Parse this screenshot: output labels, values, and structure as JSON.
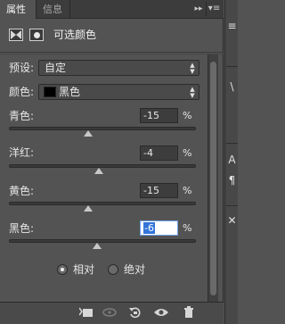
{
  "tabs": [
    {
      "label": "属性",
      "active": true
    },
    {
      "label": "信息",
      "active": false
    }
  ],
  "tab_controls": {
    "collapse": "▸▸",
    "menu": "▾≡"
  },
  "header": {
    "title": "可选颜色"
  },
  "preset": {
    "label": "预设:",
    "value": "自定"
  },
  "colors": {
    "label": "颜色:",
    "value": "黑色",
    "swatch": "#000000"
  },
  "sliders": [
    {
      "label": "青色:",
      "value": "-15",
      "unit": "%",
      "level": -15,
      "range": [
        -100,
        100
      ]
    },
    {
      "label": "洋红:",
      "value": "-4",
      "unit": "%",
      "level": -4,
      "range": [
        -100,
        100
      ]
    },
    {
      "label": "黄色:",
      "value": "-15",
      "unit": "%",
      "level": -15,
      "range": [
        -100,
        100
      ]
    },
    {
      "label": "黑色:",
      "value": "-6",
      "unit": "%",
      "level": -6,
      "range": [
        -100,
        100
      ],
      "focused": true
    }
  ],
  "method": {
    "options": [
      {
        "label": "相对",
        "selected": true
      },
      {
        "label": "绝对",
        "selected": false
      }
    ]
  },
  "toolbar": {
    "icons": [
      "clip-to-layer-icon",
      "view-previous-icon",
      "reset-icon",
      "visibility-eye-icon",
      "trash-icon"
    ]
  },
  "dock": {
    "glyphs": [
      "≡",
      "\\",
      "A",
      "¶",
      "✕"
    ]
  },
  "accent": "#3374d8"
}
